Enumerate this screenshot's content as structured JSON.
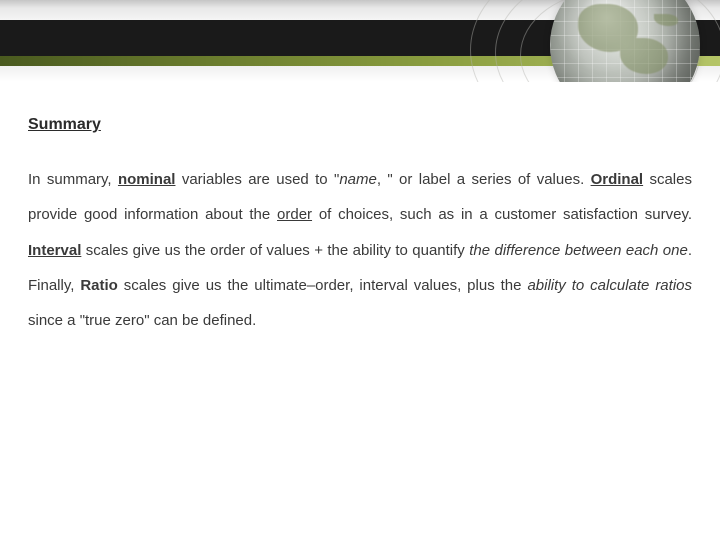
{
  "heading": "Summary",
  "p": {
    "t1": "In summary, ",
    "nominal": "nominal",
    "t2": " variables are used to \"",
    "name": "name",
    "t3": ", \" or label a series of values.   ",
    "ordinal": "Ordinal",
    "t4": " scales provide good information about the ",
    "order": "order",
    "t5": " of choices, such as in a customer satisfaction survey.  ",
    "interval": "Interval",
    "t6": " scales give us the order of values + the ability to quantify ",
    "diff": "the difference between each one",
    "t7": ".  Finally, ",
    "ratio": "Ratio",
    "t8": " scales give us the ultimate–order, interval values, plus the ",
    "ability": "ability to calculate ratios",
    "t9": " since a \"true zero\" can be defined."
  }
}
